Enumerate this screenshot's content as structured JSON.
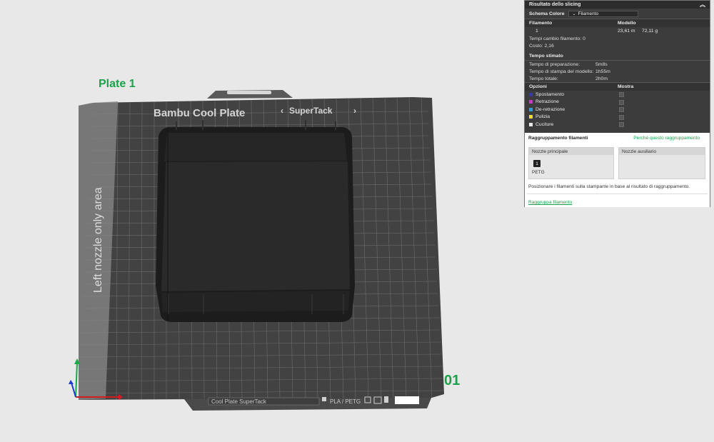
{
  "plate": {
    "label": "Plate 1",
    "number": "01",
    "bed_title": "Bambu Cool Plate",
    "bed_subtitle": "SuperTack",
    "side_text": "Left nozzle only area",
    "bottom_plate_name": "Cool Plate SuperTack",
    "bottom_material": "PLA / PETG"
  },
  "panel": {
    "title": "Risultato dello slicing",
    "schema_label": "Schema Colore",
    "schema_value": "Filamento",
    "table": {
      "col_filament": "Filamento",
      "col_model": "Modello",
      "filament_id": "1",
      "length": "23,61 m",
      "weight": "72,11 g"
    },
    "change_time": "Tempi cambio filamento:  0",
    "cost": "Costo:  2,16",
    "time_title": "Tempo stimato",
    "times": [
      {
        "label": "Tempo di preparazione:",
        "value": "5m8s"
      },
      {
        "label": "Tempo di stampa del modello:",
        "value": "1h55m"
      },
      {
        "label": "Tempo totale:",
        "value": "2h0m"
      }
    ],
    "options_title": "Opzioni",
    "show_title": "Mostra",
    "options": [
      {
        "label": "Spostamento",
        "color": "#3a3a9a"
      },
      {
        "label": "Retrazione",
        "color": "#c040c0"
      },
      {
        "label": "De-retrazione",
        "color": "#3a9ad0"
      },
      {
        "label": "Pulizia",
        "color": "#e8e020"
      },
      {
        "label": "Cuciture",
        "color": "#e8e8e8"
      }
    ]
  },
  "grouping": {
    "title": "Raggruppamento filamenti",
    "why_link": "Perché questo raggruppamento",
    "main_nozzle": "Nozzle principale",
    "aux_nozzle": "Nozzle ausiliario",
    "filament_num": "1",
    "filament_name": "PETG",
    "description": "Posizionare i filamenti sulla stampante in base al risultato di raggruppamento.",
    "group_link": "Raggruppa filamento"
  }
}
